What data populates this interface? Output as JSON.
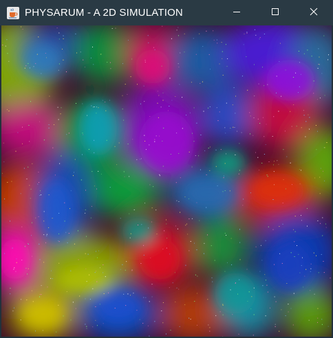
{
  "window": {
    "title": "PHYSARUM - A 2D SIMULATION",
    "app_icon": "java-coffee-cup-icon",
    "controls": {
      "minimize_icon": "minimize-icon",
      "maximize_icon": "maximize-icon",
      "close_icon": "close-icon"
    }
  },
  "simulation": {
    "description_colors": [
      "#ff0033",
      "#00cc33",
      "#0055ff",
      "#aa00cc",
      "#ffcc00",
      "#00aaaa"
    ]
  }
}
